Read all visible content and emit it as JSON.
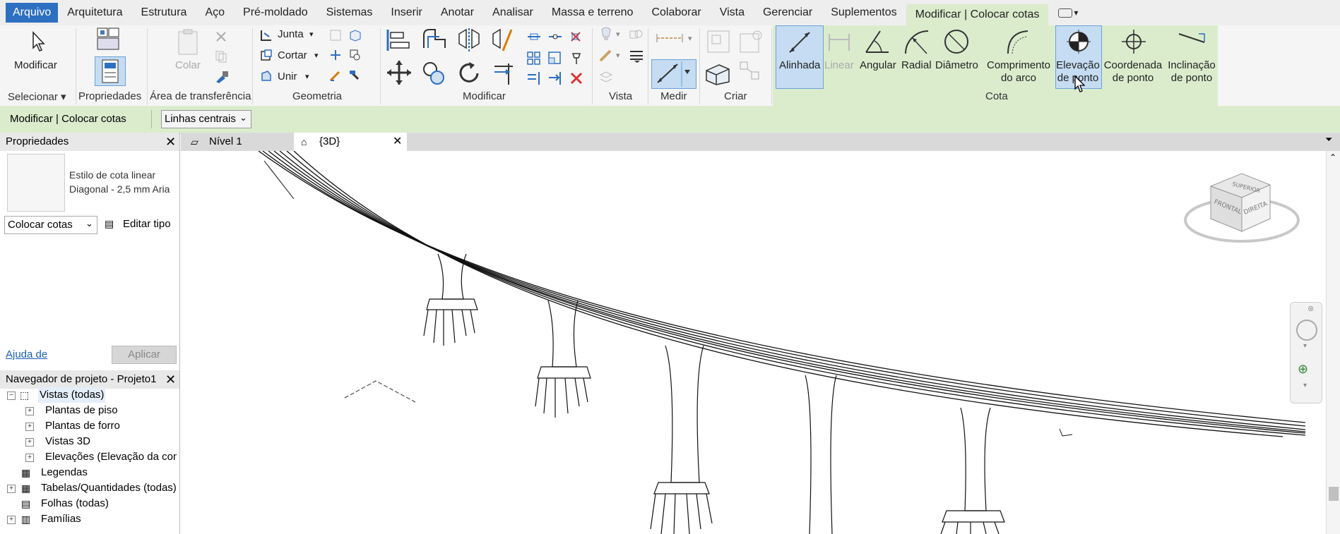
{
  "menu": {
    "tabs": [
      "Arquivo",
      "Arquitetura",
      "Estrutura",
      "Aço",
      "Pré-moldado",
      "Sistemas",
      "Inserir",
      "Anotar",
      "Analisar",
      "Massa e terreno",
      "Colaborar",
      "Vista",
      "Gerenciar",
      "Suplementos",
      "Modificar | Colocar cotas"
    ]
  },
  "ribbon": {
    "modify_label": "Modificar",
    "paste_label": "Colar",
    "panels": {
      "select": "Selecionar ▾",
      "properties": "Propriedades",
      "clipboard": "Área de transferência",
      "geometry": "Geometria",
      "modify": "Modificar",
      "view": "Vista",
      "measure": "Medir",
      "create": "Criar",
      "dimension": "Cota"
    },
    "geometry_buttons": {
      "join": "Junta",
      "cut": "Cortar",
      "unite": "Unir"
    },
    "dimension_tools": [
      "Alinhada",
      "Linear",
      "Angular",
      "Radial",
      "Diâmetro",
      "Comprimento do arco",
      "Elevação de ponto",
      "Coordenada de ponto",
      "Inclinação de ponto"
    ]
  },
  "options_bar": {
    "context_label": "Modificar | Colocar cotas",
    "reference_select": "Linhas centrais"
  },
  "properties": {
    "title": "Propriedades",
    "type_line1": "Estilo de cota linear",
    "type_line2": "Diagonal - 2,5 mm Aria",
    "instance_select": "Colocar cotas",
    "edit_type": "Editar tipo",
    "help_link": "Ajuda de",
    "apply_button": "Aplicar"
  },
  "navigator": {
    "title": "Navegador de projeto - Projeto1",
    "items": [
      "Vistas (todas)",
      "Plantas de piso",
      "Plantas de forro",
      "Vistas 3D",
      "Elevações (Elevação da const",
      "Legendas",
      "Tabelas/Quantidades (todas)",
      "Folhas (todas)",
      "Famílias"
    ]
  },
  "view_tabs": [
    "Nível 1",
    "{3D}"
  ],
  "viewcube": {
    "top": "SUPERIOR",
    "front": "FRONTAL",
    "right": "DIREITA"
  },
  "colors": {
    "menu_active": "#2d6fc1",
    "context_green": "#dbeccd",
    "active_tool": "#c5dcf2"
  }
}
